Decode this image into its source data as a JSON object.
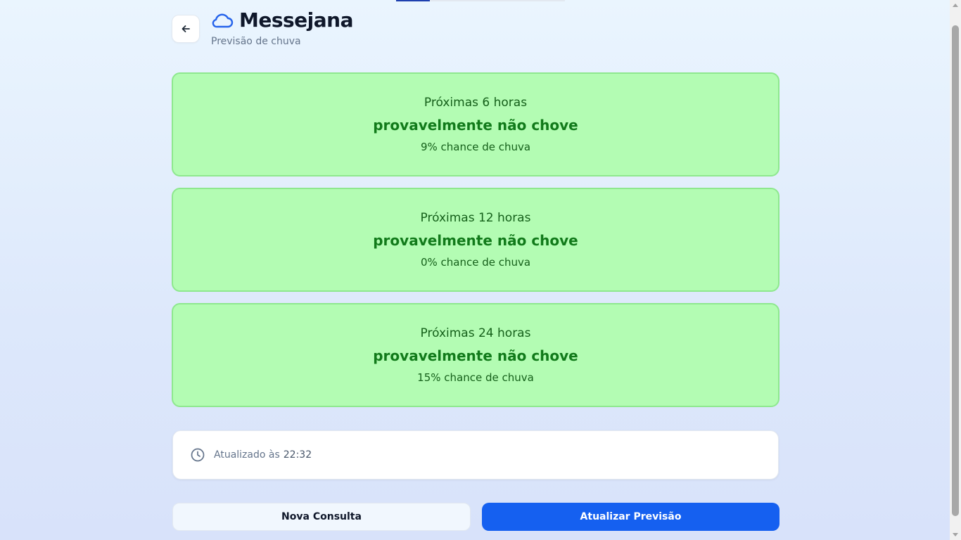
{
  "header": {
    "title": "Messejana",
    "subtitle": "Previsão de chuva",
    "back_icon": "arrow-left-icon",
    "title_icon": "cloud-icon"
  },
  "forecasts": [
    {
      "period": "Próximas 6 horas",
      "verdict": "provavelmente não chove",
      "chance": "9% chance de chuva"
    },
    {
      "period": "Próximas 12 horas",
      "verdict": "provavelmente não chove",
      "chance": "0% chance de chuva"
    },
    {
      "period": "Próximas 24 horas",
      "verdict": "provavelmente não chove",
      "chance": "15% chance de chuva"
    }
  ],
  "updated": {
    "icon": "clock-icon",
    "label": "Atualizado às",
    "time": "22:32"
  },
  "actions": {
    "new_query_label": "Nova Consulta",
    "refresh_label": "Atualizar Previsão"
  },
  "colors": {
    "card_background": "#b3fcb3",
    "card_border": "#8ee88e",
    "verdict_text": "#117a1a",
    "primary_button": "#1560f0",
    "cloud_icon": "#2563eb"
  }
}
